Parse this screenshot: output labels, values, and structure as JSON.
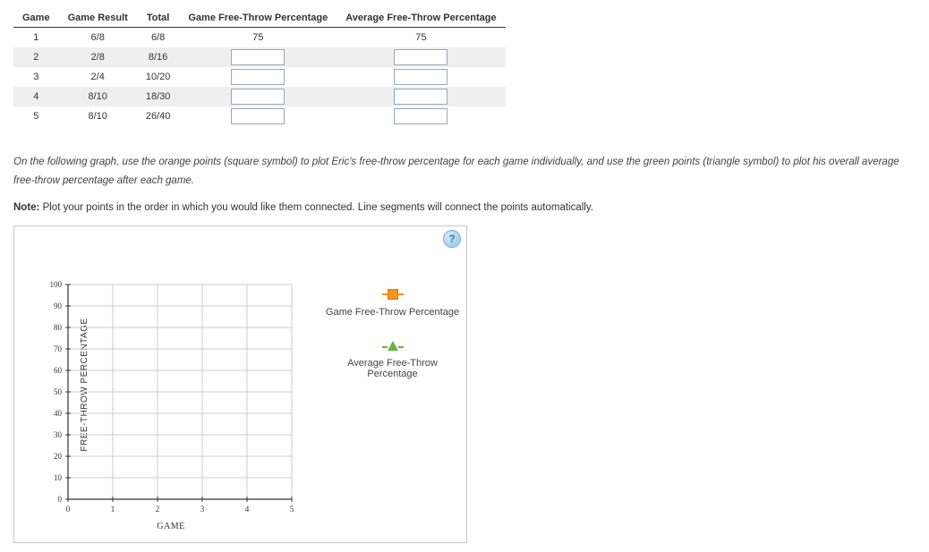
{
  "table": {
    "headers": [
      "Game",
      "Game Result",
      "Total",
      "Game Free-Throw Percentage",
      "Average Free-Throw Percentage"
    ],
    "rows": [
      {
        "game": "1",
        "result": "6/8",
        "total": "6/8",
        "gpct": "75",
        "apct": "75",
        "input": false
      },
      {
        "game": "2",
        "result": "2/8",
        "total": "8/16",
        "gpct": "",
        "apct": "",
        "input": true
      },
      {
        "game": "3",
        "result": "2/4",
        "total": "10/20",
        "gpct": "",
        "apct": "",
        "input": true
      },
      {
        "game": "4",
        "result": "8/10",
        "total": "18/30",
        "gpct": "",
        "apct": "",
        "input": true
      },
      {
        "game": "5",
        "result": "8/10",
        "total": "26/40",
        "gpct": "",
        "apct": "",
        "input": true
      }
    ]
  },
  "instructions": "On the following graph, use the orange points (square symbol) to plot Eric's free-throw percentage for each game individually, and use the green points (triangle symbol) to plot his overall average free-throw percentage after each game.",
  "note_label": "Note:",
  "note_text": " Plot your points in the order in which you would like them connected. Line segments will connect the points automatically.",
  "help_icon": "?",
  "legend": {
    "series1": "Game Free-Throw Percentage",
    "series2": "Average Free-Throw Percentage"
  },
  "chart_data": {
    "type": "scatter",
    "xlabel": "GAME",
    "ylabel": "FREE-THROW PERCENTAGE",
    "x_ticks": [
      0,
      1,
      2,
      3,
      4,
      5
    ],
    "y_ticks": [
      0,
      10,
      20,
      30,
      40,
      50,
      60,
      70,
      80,
      90,
      100
    ],
    "xlim": [
      0,
      5
    ],
    "ylim": [
      0,
      100
    ],
    "series": [
      {
        "name": "Game Free-Throw Percentage",
        "marker": "square",
        "color": "#f7941d",
        "values": []
      },
      {
        "name": "Average Free-Throw Percentage",
        "marker": "triangle",
        "color": "#64b53a",
        "values": []
      }
    ]
  }
}
